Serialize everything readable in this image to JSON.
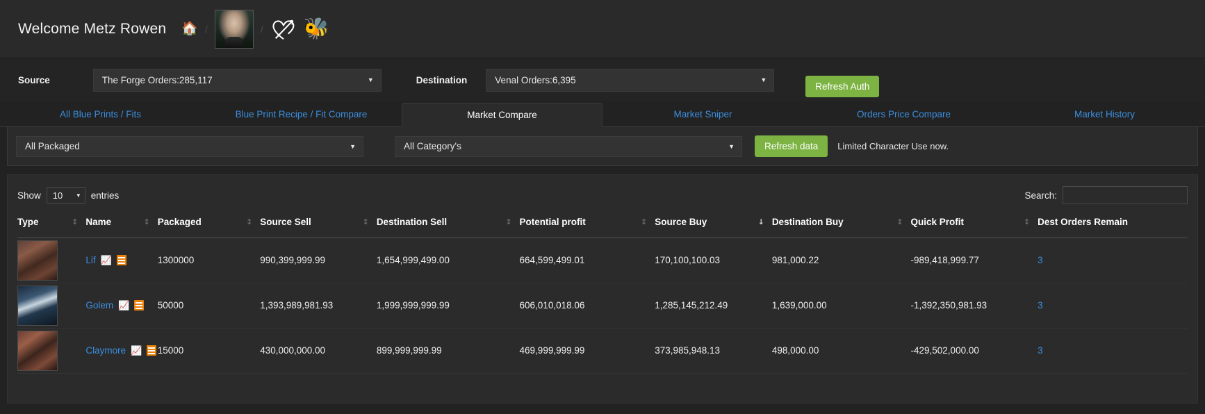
{
  "header": {
    "welcome": "Welcome Metz Rowen",
    "home_icon": "home-icon",
    "separator": "/",
    "avatar_icon": "avatar-portrait",
    "heart_icon": "heart-with-arrow-icon",
    "bee_icon": "🐝"
  },
  "selectors": {
    "source_label": "Source",
    "source_value": "The Forge Orders:285,117",
    "destination_label": "Destination",
    "destination_value": "Venal Orders:6,395",
    "refresh_auth_label": "Refresh Auth",
    "caret": "▼"
  },
  "tabs": [
    {
      "label": "All Blue Prints / Fits",
      "active": false
    },
    {
      "label": "Blue Print Recipe / Fit Compare",
      "active": false
    },
    {
      "label": "Market Compare",
      "active": true
    },
    {
      "label": "Market Sniper",
      "active": false
    },
    {
      "label": "Orders Price Compare",
      "active": false
    },
    {
      "label": "Market History",
      "active": false
    }
  ],
  "filters": {
    "packaged_value": "All Packaged",
    "category_value": "All Category's",
    "refresh_data_label": "Refresh data",
    "notice": "Limited Character Use now."
  },
  "table_controls": {
    "show_label": "Show",
    "entries_label": "entries",
    "page_length": "10",
    "search_label": "Search:",
    "search_value": "",
    "search_placeholder": ""
  },
  "table": {
    "columns": [
      {
        "label": "Type",
        "sort": "none"
      },
      {
        "label": "Name",
        "sort": "none"
      },
      {
        "label": "Packaged",
        "sort": "none"
      },
      {
        "label": "Source Sell",
        "sort": "none"
      },
      {
        "label": "Destination Sell",
        "sort": "none"
      },
      {
        "label": "Potential profit",
        "sort": "none"
      },
      {
        "label": "Source Buy",
        "sort": "desc"
      },
      {
        "label": "Destination Buy",
        "sort": "none"
      },
      {
        "label": "Quick Profit",
        "sort": "none"
      },
      {
        "label": "Dest Orders Remain",
        "sort": "none"
      }
    ],
    "rows": [
      {
        "type_icon": "ship-thumbnail-lif",
        "name": "Lif",
        "packaged": "1300000",
        "source_sell": "990,399,999.99",
        "destination_sell": "1,654,999,499.00",
        "potential_profit": "664,599,499.01",
        "source_buy": "170,100,100.03",
        "destination_buy": "981,000.22",
        "quick_profit": "-989,418,999.77",
        "dest_orders_remain": "3"
      },
      {
        "type_icon": "ship-thumbnail-golem",
        "name": "Golem",
        "packaged": "50000",
        "source_sell": "1,393,989,981.93",
        "destination_sell": "1,999,999,999.99",
        "potential_profit": "606,010,018.06",
        "source_buy": "1,285,145,212.49",
        "destination_buy": "1,639,000.00",
        "quick_profit": "-1,392,350,981.93",
        "dest_orders_remain": "3"
      },
      {
        "type_icon": "ship-thumbnail-claymore",
        "name": "Claymore",
        "packaged": "15000",
        "source_sell": "430,000,000.00",
        "destination_sell": "899,999,999.99",
        "potential_profit": "469,999,999.99",
        "source_buy": "373,985,948.13",
        "destination_buy": "498,000.00",
        "quick_profit": "-429,502,000.00",
        "dest_orders_remain": "3"
      }
    ]
  },
  "colors": {
    "accent_link": "#3b8ede",
    "button_green": "#7cb342",
    "note_orange": "#e8820c",
    "page_bg": "#222222",
    "panel_bg": "#2b2b2b"
  }
}
